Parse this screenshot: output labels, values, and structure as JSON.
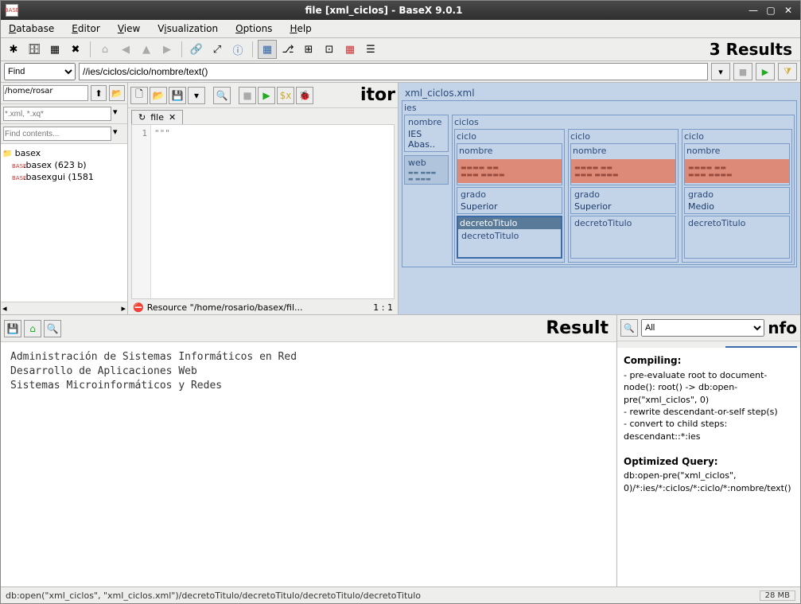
{
  "window": {
    "title": "file [xml_ciclos] - BaseX 9.0.1",
    "icon_label": "BASE"
  },
  "menubar": {
    "items": [
      "Database",
      "Editor",
      "View",
      "Visualization",
      "Options",
      "Help"
    ]
  },
  "toolbar": {
    "results": "3 Results"
  },
  "findbar": {
    "mode": "Find",
    "query": "//ies/ciclos/ciclo/nombre/text()"
  },
  "project": {
    "path": "/home/rosar",
    "filter_placeholder": "*.xml, *.xq*",
    "find_placeholder": "Find contents...",
    "root": "basex",
    "files": [
      {
        "name": ".basex (623 b)"
      },
      {
        "name": ".basexgui (1581"
      }
    ]
  },
  "editor": {
    "label": "itor",
    "tab": "file",
    "gutter": "1",
    "content": "\"\"\"",
    "status_icon": "error",
    "status_text": "Resource \"/home/rosario/basex/fil...",
    "pos": "1 : 1"
  },
  "map": {
    "doc": "xml_ciclos.xml",
    "root": "ies",
    "nombre_label": "nombre",
    "nombre_value": "IES\nAbas..",
    "web_label": "web",
    "ciclos_label": "ciclos",
    "ciclos": [
      {
        "ciclo": "ciclo",
        "nombre": "nombre",
        "grado_label": "grado",
        "grado": "Superior",
        "decreto_label": "decretoTitulo",
        "decreto": "decretoTitulo",
        "sel": true
      },
      {
        "ciclo": "ciclo",
        "nombre": "nombre",
        "grado_label": "grado",
        "grado": "Superior",
        "decreto_label": "decretoTitulo",
        "decreto": "decretoTitulo",
        "sel": false
      },
      {
        "ciclo": "ciclo",
        "nombre": "nombre",
        "grado_label": "grado",
        "grado": "Medio",
        "decreto_label": "decretoTitulo",
        "decreto": "decretoTitulo",
        "sel": false
      }
    ],
    "map_tooltip": "decretoTitulo"
  },
  "result": {
    "title": "Result",
    "lines": [
      "Administración de Sistemas Informáticos en Red",
      "Desarrollo de Aplicaciones Web",
      "Sistemas Microinformáticos y Redes"
    ]
  },
  "info": {
    "title": "nfo",
    "filter": "All",
    "compiling_h": "Compiling:",
    "compiling": "- pre-evaluate root to document-node(): root() -> db:open-pre(\"xml_ciclos\", 0)\n- rewrite descendant-or-self step(s)\n- convert to child steps: descendant::*:ies",
    "opt_h": "Optimized Query:",
    "opt": "db:open-pre(\"xml_ciclos\", 0)/*:ies/*:ciclos/*:ciclo/*:nombre/text()"
  },
  "statusbar": {
    "path": "db:open(\"xml_ciclos\", \"xml_ciclos.xml\")/decretoTitulo/decretoTitulo/decretoTitulo/decretoTitulo",
    "mem": "28 MB"
  }
}
